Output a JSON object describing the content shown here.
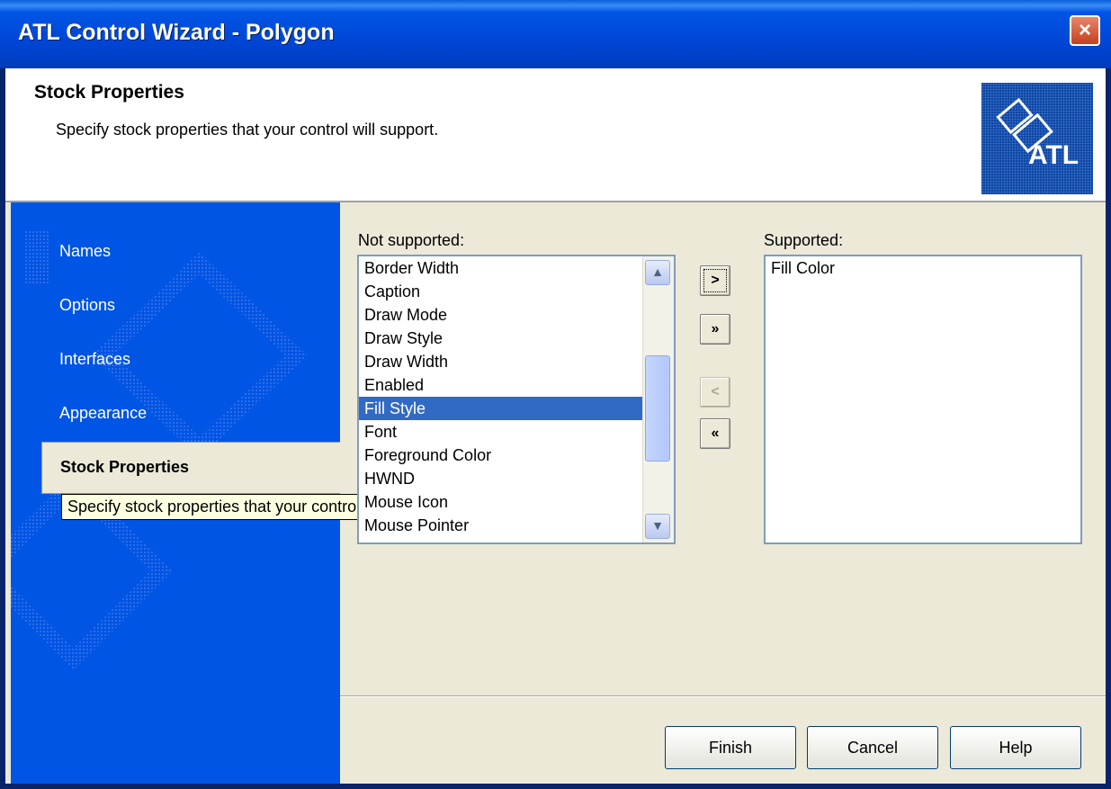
{
  "window": {
    "title": "ATL Control Wizard - Polygon",
    "close_label": "×"
  },
  "header": {
    "title": "Stock Properties",
    "subtitle": "Specify stock properties that your control will support.",
    "logo_text": "ATL"
  },
  "sidebar": {
    "items": [
      {
        "label": "Names"
      },
      {
        "label": "Options"
      },
      {
        "label": "Interfaces"
      },
      {
        "label": "Appearance"
      },
      {
        "label": "Stock Properties"
      }
    ],
    "active_index": 4,
    "tooltip": "Specify stock properties that your control will support."
  },
  "not_supported": {
    "label": "Not supported:",
    "items": [
      "Border Width",
      "Caption",
      "Draw Mode",
      "Draw Style",
      "Draw Width",
      "Enabled",
      "Fill Style",
      "Font",
      "Foreground Color",
      "HWND",
      "Mouse Icon",
      "Mouse Pointer"
    ],
    "selected": "Fill Style"
  },
  "supported": {
    "label": "Supported:",
    "items": [
      "Fill Color"
    ]
  },
  "move_buttons": {
    "add": ">",
    "add_all": "»",
    "remove": "<",
    "remove_all": "«"
  },
  "buttons": {
    "finish": "Finish",
    "cancel": "Cancel",
    "help": "Help"
  },
  "colors": {
    "title_bar": "#0055e5",
    "sidebar": "#0055e5",
    "selection": "#316ac5",
    "dialog_bg": "#ece9d8"
  }
}
